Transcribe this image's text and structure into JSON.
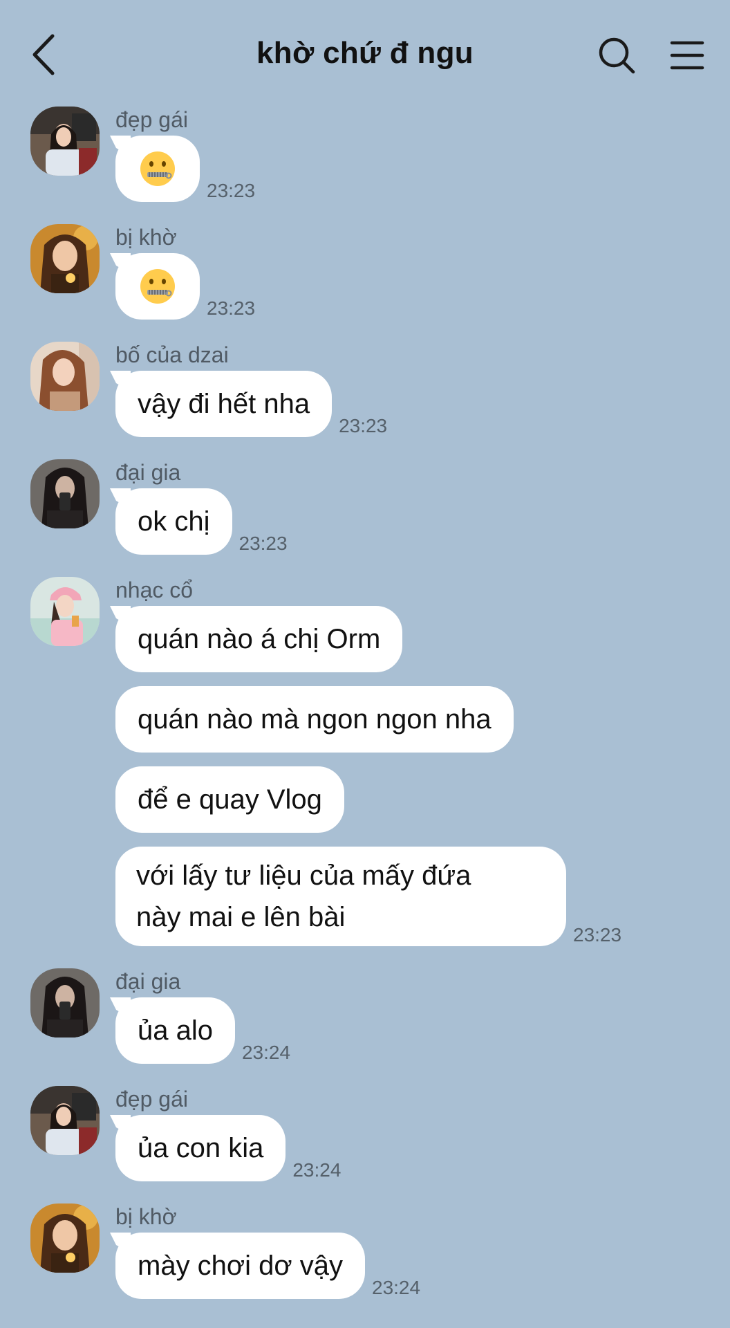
{
  "header": {
    "title": "khờ chứ đ ngu"
  },
  "groups": [
    {
      "sender": "đẹp gái",
      "avatar": "avatar-girl-indoor",
      "messages": [
        {
          "type": "emoji",
          "icon": "zipper-mouth-face-icon",
          "time": "23:23"
        }
      ]
    },
    {
      "sender": "bị khờ",
      "avatar": "avatar-girl-warm",
      "messages": [
        {
          "type": "emoji",
          "icon": "zipper-mouth-face-icon",
          "time": "23:23"
        }
      ]
    },
    {
      "sender": "bố của dzai",
      "avatar": "avatar-girl-light",
      "messages": [
        {
          "type": "text",
          "text": "vậy đi hết nha",
          "time": "23:23"
        }
      ]
    },
    {
      "sender": "đại gia",
      "avatar": "avatar-girl-mirror",
      "messages": [
        {
          "type": "text",
          "text": "ok chị",
          "time": "23:23"
        }
      ]
    },
    {
      "sender": "nhạc cổ",
      "avatar": "avatar-girl-pink",
      "messages": [
        {
          "type": "text",
          "text": "quán nào á chị Orm",
          "time": ""
        },
        {
          "type": "text",
          "text": "quán nào mà ngon ngon nha",
          "time": ""
        },
        {
          "type": "text",
          "text": "để e quay Vlog",
          "time": ""
        },
        {
          "type": "multi",
          "lines": [
            "với lấy tư liệu của mấy đứa",
            "này mai e lên bài"
          ],
          "time": "23:23"
        }
      ]
    },
    {
      "sender": "đại gia",
      "avatar": "avatar-girl-mirror",
      "messages": [
        {
          "type": "text",
          "text": "ủa alo",
          "time": "23:24"
        }
      ]
    },
    {
      "sender": "đẹp gái",
      "avatar": "avatar-girl-indoor",
      "messages": [
        {
          "type": "text",
          "text": "ủa con kia",
          "time": "23:24"
        }
      ]
    },
    {
      "sender": "bị khờ",
      "avatar": "avatar-girl-warm",
      "messages": [
        {
          "type": "text",
          "text": "mày chơi dơ vậy",
          "time": "23:24"
        }
      ]
    }
  ]
}
